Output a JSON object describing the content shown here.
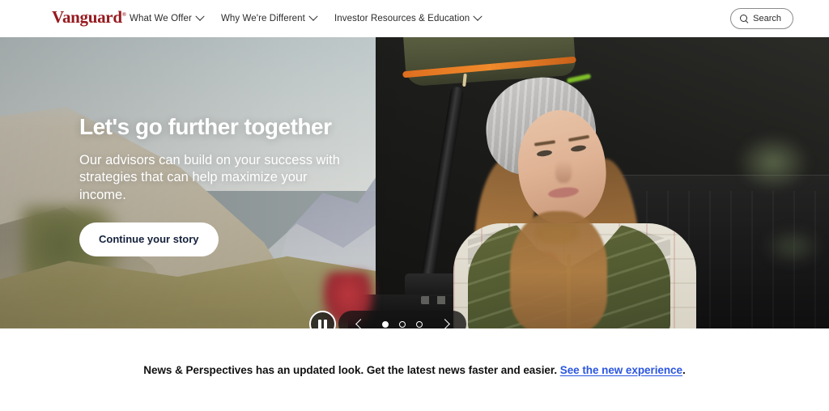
{
  "header": {
    "logo_text": "Vanguard",
    "logo_mark": "®",
    "nav_items": [
      {
        "label": "What We Offer",
        "icon": "chevron-down-icon"
      },
      {
        "label": "Why We're Different",
        "icon": "chevron-down-icon"
      },
      {
        "label": "Investor Resources & Education",
        "icon": "chevron-down-icon"
      }
    ],
    "search": {
      "label": "Search",
      "icon": "search-icon"
    },
    "brand_color": "#961a1f"
  },
  "hero": {
    "title": "Let's go further together",
    "subtitle": "Our advisors can build on your success with strategies that can help maximize your income.",
    "cta_label": "Continue your story",
    "image_alt": "Woman in grey beanie and olive puffer vest leaning on a pickup truck with mountains behind",
    "carousel": {
      "pause_icon": "pause-icon",
      "prev_icon": "chevron-left-icon",
      "next_icon": "chevron-right-icon",
      "slide_count": 3,
      "active_slide": 1
    }
  },
  "banner": {
    "text": "News & Perspectives has an updated look. Get the latest news faster and easier. ",
    "link_text": "See the new experience",
    "trailing": ".",
    "link_color": "#2b56e0"
  }
}
